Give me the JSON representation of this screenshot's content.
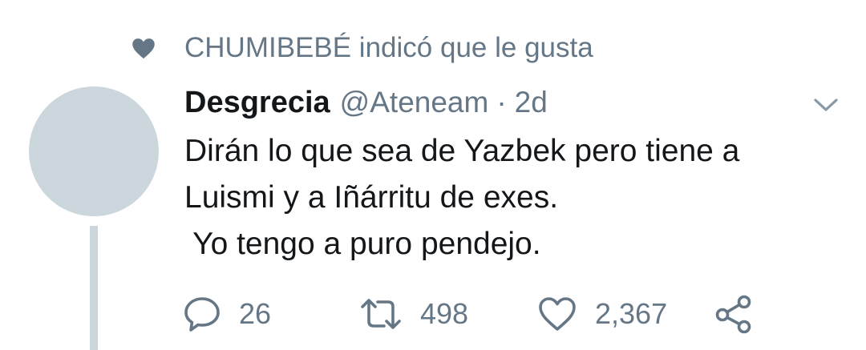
{
  "context": {
    "icon": "heart-filled-icon",
    "text": "CHUMIBEBÉ indicó que le gusta"
  },
  "tweet": {
    "display_name": "Desgrecia",
    "handle": "@Ateneam",
    "separator": "·",
    "time": "2d",
    "text_lines": [
      "Dirán lo que sea de Yazbek pero tiene a",
      "Luismi y a Iñárritu de exes.",
      " Yo tengo a puro pendejo."
    ],
    "actions": {
      "reply": {
        "icon": "reply-icon",
        "count": "26"
      },
      "retweet": {
        "icon": "retweet-icon",
        "count": "498"
      },
      "like": {
        "icon": "heart-outline-icon",
        "count": "2,367"
      },
      "share": {
        "icon": "share-icon"
      }
    }
  },
  "colors": {
    "secondary_text": "#657786",
    "primary_text": "#14171a",
    "avatar_placeholder": "#ccd6dd"
  }
}
